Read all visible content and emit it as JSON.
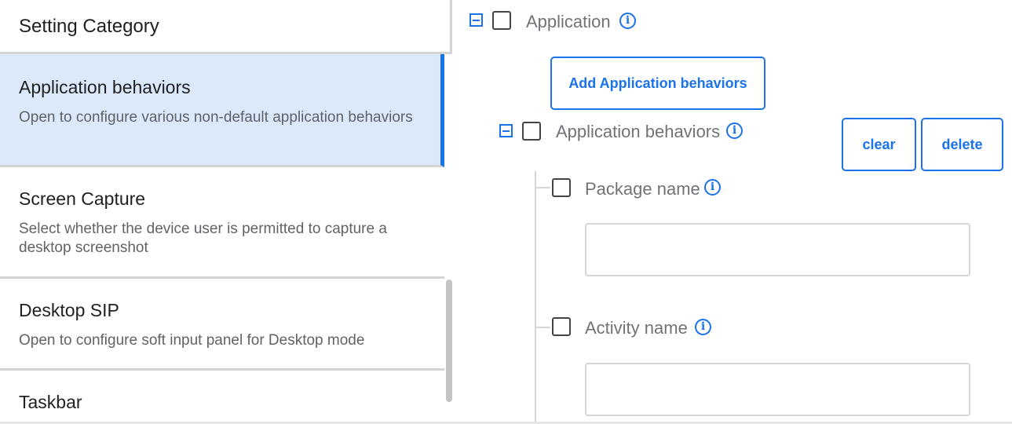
{
  "sidebar": {
    "header": "Setting Category",
    "items": [
      {
        "title": "Application behaviors",
        "description": "Open to configure various non-default application behaviors"
      },
      {
        "title": "Screen Capture",
        "description": "Select whether the device user is permitted to capture a desktop screenshot"
      },
      {
        "title": "Desktop SIP",
        "description": "Open to configure soft input panel for Desktop mode"
      },
      {
        "title": "Taskbar",
        "description": ""
      }
    ],
    "selected_index": 0
  },
  "panel": {
    "root_label": "Application",
    "add_button_label": "Add Application behaviors",
    "group_label": "Application behaviors",
    "clear_label": "clear",
    "delete_label": "delete",
    "fields": [
      {
        "label": "Package name",
        "value": ""
      },
      {
        "label": "Activity name",
        "value": ""
      }
    ]
  },
  "icons": {
    "info": "info-icon",
    "collapse": "collapse-minus-icon",
    "checkbox": "checkbox-unchecked"
  },
  "colors": {
    "accent": "#1a73e8",
    "selected_bg": "#dce9fb",
    "divider": "#d4d4d4"
  }
}
